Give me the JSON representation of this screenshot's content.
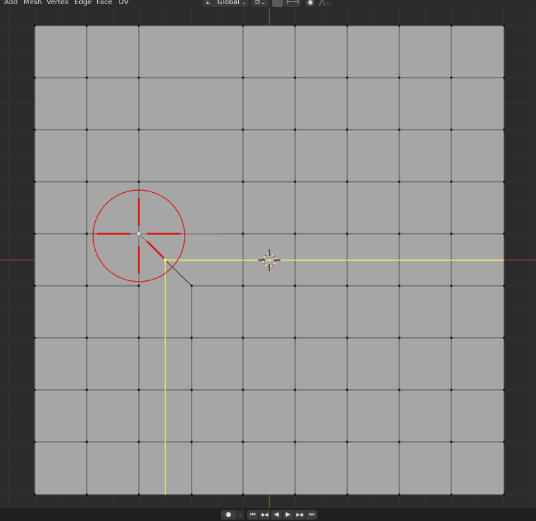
{
  "menu": {
    "add": "Add",
    "mesh": "Mesh",
    "vertex": "Vertex",
    "edge": "Edge",
    "face": "Face",
    "uv": "UV"
  },
  "header": {
    "transform_orientation": "Global"
  },
  "icons": {
    "orientation": "transform-orientation-icon",
    "pivot": "pivot-point-icon",
    "snap": "snap-icon",
    "snap_target": "snap-increment-icon",
    "proportional": "proportional-edit-icon",
    "falloff": "proportional-falloff-icon",
    "cursor": "3d-cursor-icon"
  },
  "timeline": {
    "record": "●",
    "jump_start": "⏮",
    "prev_key": "◆◀",
    "play_reverse": "◀",
    "play": "▶",
    "next_key": "▶◆",
    "jump_end": "⏭"
  },
  "colors": {
    "background": "#2b2b2b",
    "mesh_face": "#a6a6a6",
    "selected_edge": "#e8e86a",
    "x_axis": "#b83a3a",
    "knife_tool": "#e01010"
  }
}
